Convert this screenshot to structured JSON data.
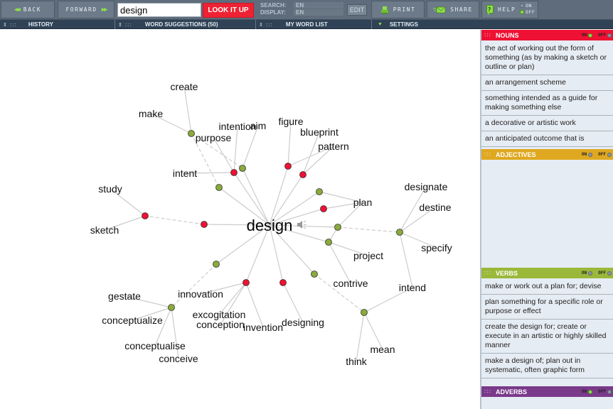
{
  "toolbar": {
    "back_label": "BACK",
    "forward_label": "FORWARD",
    "search_value": "design",
    "lookup_label": "LOOK IT UP",
    "search_lang_label": "SEARCH:",
    "search_lang_value": "EN",
    "display_lang_label": "DISPLAY:",
    "display_lang_value": "EN",
    "edit_label": "EDIT",
    "print_label": "PRINT",
    "share_label": "SHARE",
    "help_label": "HELP",
    "help_on_label": "ON",
    "help_off_label": "OFF",
    "help_state": "off"
  },
  "panelbar": {
    "history_label": "HISTORY",
    "suggestions_label": "WORD SUGGESTIONS (50)",
    "wordlist_label": "MY WORD LIST",
    "settings_label": "SETTINGS"
  },
  "graph": {
    "center_word": "design",
    "colors": {
      "noun": "#ee1133",
      "verb": "#8aaa3a",
      "edge": "#cccccc"
    },
    "words": [
      "create",
      "make",
      "purpose",
      "intention",
      "aim",
      "intent",
      "figure",
      "blueprint",
      "pattern",
      "study",
      "sketch",
      "plan",
      "designate",
      "destine",
      "specify",
      "project",
      "contrive",
      "intend",
      "innovation",
      "gestate",
      "conceptualize",
      "conceptualise",
      "conceive",
      "excogitation",
      "conception",
      "invention",
      "designing",
      "think",
      "mean"
    ]
  },
  "sidebar": {
    "on_label": "ON",
    "off_label": "OFF",
    "nouns": {
      "title": "NOUNS",
      "color": "#ee1133",
      "definitions": [
        "the act of working out the form of something (as by making a sketch or outline or plan)",
        "an arrangement scheme",
        "something intended as a guide for making something else",
        "a decorative or artistic work",
        "an anticipated outcome that is"
      ]
    },
    "adjectives": {
      "title": "ADJECTIVES",
      "color": "#e0a820",
      "definitions": []
    },
    "verbs": {
      "title": "VERBS",
      "color": "#9ab83a",
      "definitions": [
        "make or work out a plan for; devise",
        "plan something for a specific role or purpose or effect",
        "create the design for; create or execute in an artistic or highly skilled manner",
        "make a design of; plan out in systematic, often graphic form"
      ]
    },
    "adverbs": {
      "title": "ADVERBS",
      "color": "#7a3a8a",
      "definitions": []
    }
  }
}
